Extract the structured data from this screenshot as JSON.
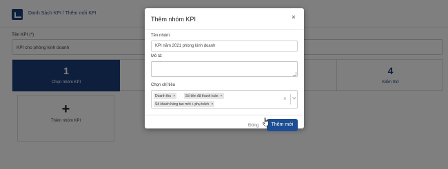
{
  "header": {
    "breadcrumb": "Danh Sách KPI / Thêm mới KPI"
  },
  "form": {
    "kpi_label": "Tên KPI (*)",
    "kpi_value": "KPI cho phòng kinh doanh"
  },
  "cards": [
    {
      "number": "1",
      "label": "Chọn nhóm KPI"
    },
    {
      "number": "4",
      "label": "Kiểm thử"
    }
  ],
  "add_group": {
    "icon": "plus-icon",
    "label": "Thêm nhóm KPI"
  },
  "modal": {
    "title": "Thêm nhóm KPI",
    "name_label": "Tên nhóm:",
    "name_value": "KPI năm 2021 phòng kinh doanh",
    "desc_label": "Mô tả:",
    "criteria_label": "Chọn chỉ tiêu",
    "criteria_tags": [
      "Doanh thu",
      "Số tiền đã thanh toán",
      "Số khách hàng tạo mới + phụ trách"
    ],
    "close_button": "Đóng",
    "submit_button": "Thêm mới"
  },
  "colors": {
    "brand": "#1d3f7a",
    "button": "#1d4e94"
  }
}
